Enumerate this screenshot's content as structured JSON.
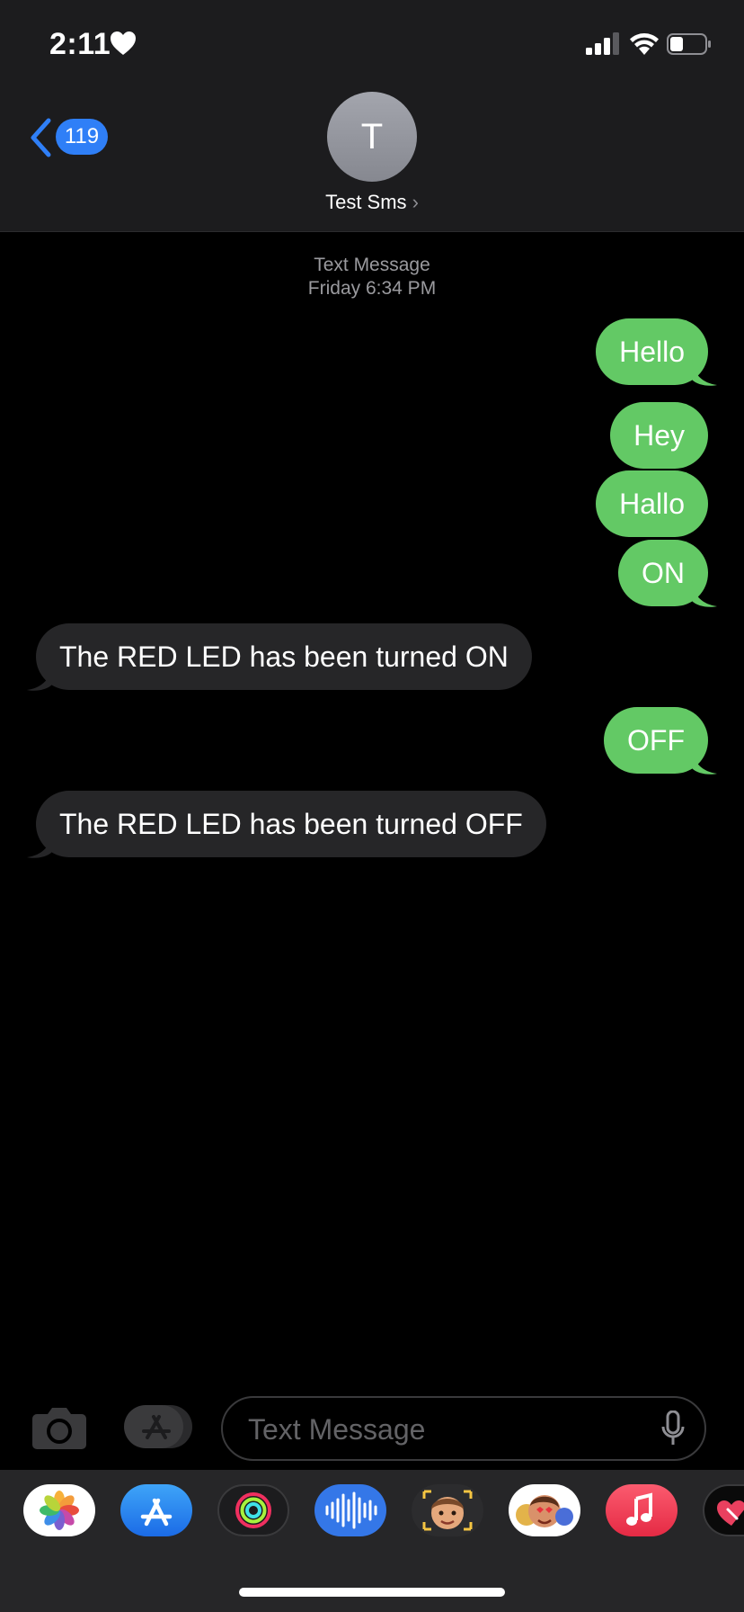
{
  "status_bar": {
    "time": "2:11"
  },
  "header": {
    "back_count": "119",
    "avatar_initial": "T",
    "contact_name": "Test Sms",
    "name_chevron": "›"
  },
  "thread": {
    "service": "Text Message",
    "timestamp": "Friday 6:34 PM"
  },
  "messages": [
    {
      "direction": "sent",
      "text": "Hello"
    },
    {
      "direction": "sent",
      "text": "Hey"
    },
    {
      "direction": "sent",
      "text": "Hallo"
    },
    {
      "direction": "sent",
      "text": "ON"
    },
    {
      "direction": "received",
      "text": "The RED LED has been turned ON"
    },
    {
      "direction": "sent",
      "text": "OFF"
    },
    {
      "direction": "received",
      "text": "The RED LED has been turned OFF"
    }
  ],
  "composer": {
    "placeholder": "Text Message"
  },
  "app_drawer": [
    {
      "name": "photos-icon"
    },
    {
      "name": "app-store-icon"
    },
    {
      "name": "activity-icon"
    },
    {
      "name": "audio-message-icon"
    },
    {
      "name": "memoji-icon"
    },
    {
      "name": "memoji-stickers-icon"
    },
    {
      "name": "music-icon"
    },
    {
      "name": "digital-touch-icon"
    }
  ],
  "colors": {
    "sent_bubble": "#63c965",
    "received_bubble": "#262628",
    "badge": "#2f7ff7",
    "background": "#000000"
  }
}
